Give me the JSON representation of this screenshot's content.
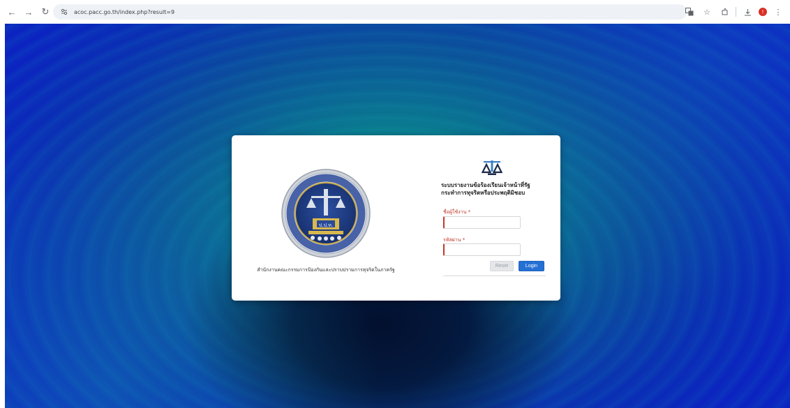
{
  "browser": {
    "url": "acoc.pacc.go.th/index.php?result=9",
    "icons": [
      "back-icon",
      "forward-icon",
      "reload-icon",
      "site-info-icon",
      "translate-icon",
      "bookmark-star-icon",
      "extensions-icon",
      "download-icon",
      "profile-icon",
      "more-menu-icon"
    ]
  },
  "login_card": {
    "organization_name": "สำนักงานคณะกรรมการป้องกันและปราบปรามการทุจริตในภาครัฐ",
    "system_title_line1": "ระบบรายงานข้อร้องเรียนเจ้าหน้าที่รัฐ",
    "system_title_line2": "กระทำการทุจริตหรือประพฤติมิชอบ",
    "username_label": "ชื่อผู้ใช้งาน *",
    "username_value": "",
    "password_label": "รหัสผ่าน *",
    "password_value": "",
    "reset_label": "Reset",
    "login_label": "Login"
  },
  "colors": {
    "accent": "#2470d4",
    "required": "#c0392b",
    "background_blue": "#0b22c0",
    "background_teal": "#0a7c8e"
  }
}
